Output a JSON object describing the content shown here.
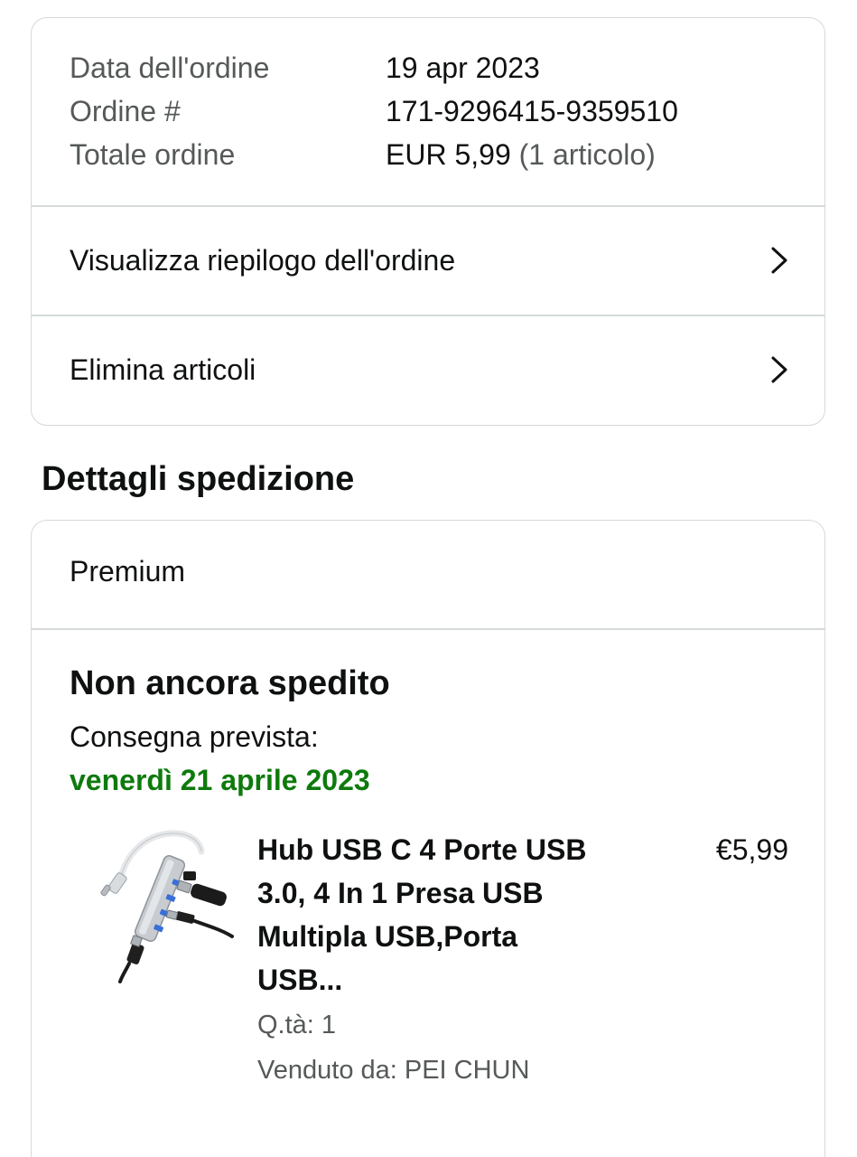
{
  "order_summary": {
    "rows": [
      {
        "label": "Data dell'ordine",
        "value": "19 apr 2023"
      },
      {
        "label": "Ordine #",
        "value": "171-9296415-9359510"
      },
      {
        "label": "Totale ordine",
        "value": "EUR 5,99",
        "value_suffix": "(1 articolo)"
      }
    ],
    "links": [
      {
        "label": "Visualizza riepilogo dell'ordine",
        "icon": "chevron-right-icon"
      },
      {
        "label": "Elimina articoli",
        "icon": "chevron-right-icon"
      }
    ]
  },
  "shipping": {
    "section_title": "Dettagli spedizione",
    "type": "Premium",
    "status": "Non ancora spedito",
    "delivery_label": "Consegna prevista:",
    "delivery_date": "venerdì 21 aprile 2023",
    "delivery_date_color": "#0e7a0d",
    "item": {
      "title": "Hub USB C 4 Porte USB 3.0, 4 In 1 Presa USB Multipla USB,Porta USB...",
      "price": "€5,99",
      "quantity": "Q.tà: 1",
      "seller": "Venduto da: PEI CHUN",
      "image_icon": "usb-hub-product-image"
    }
  }
}
